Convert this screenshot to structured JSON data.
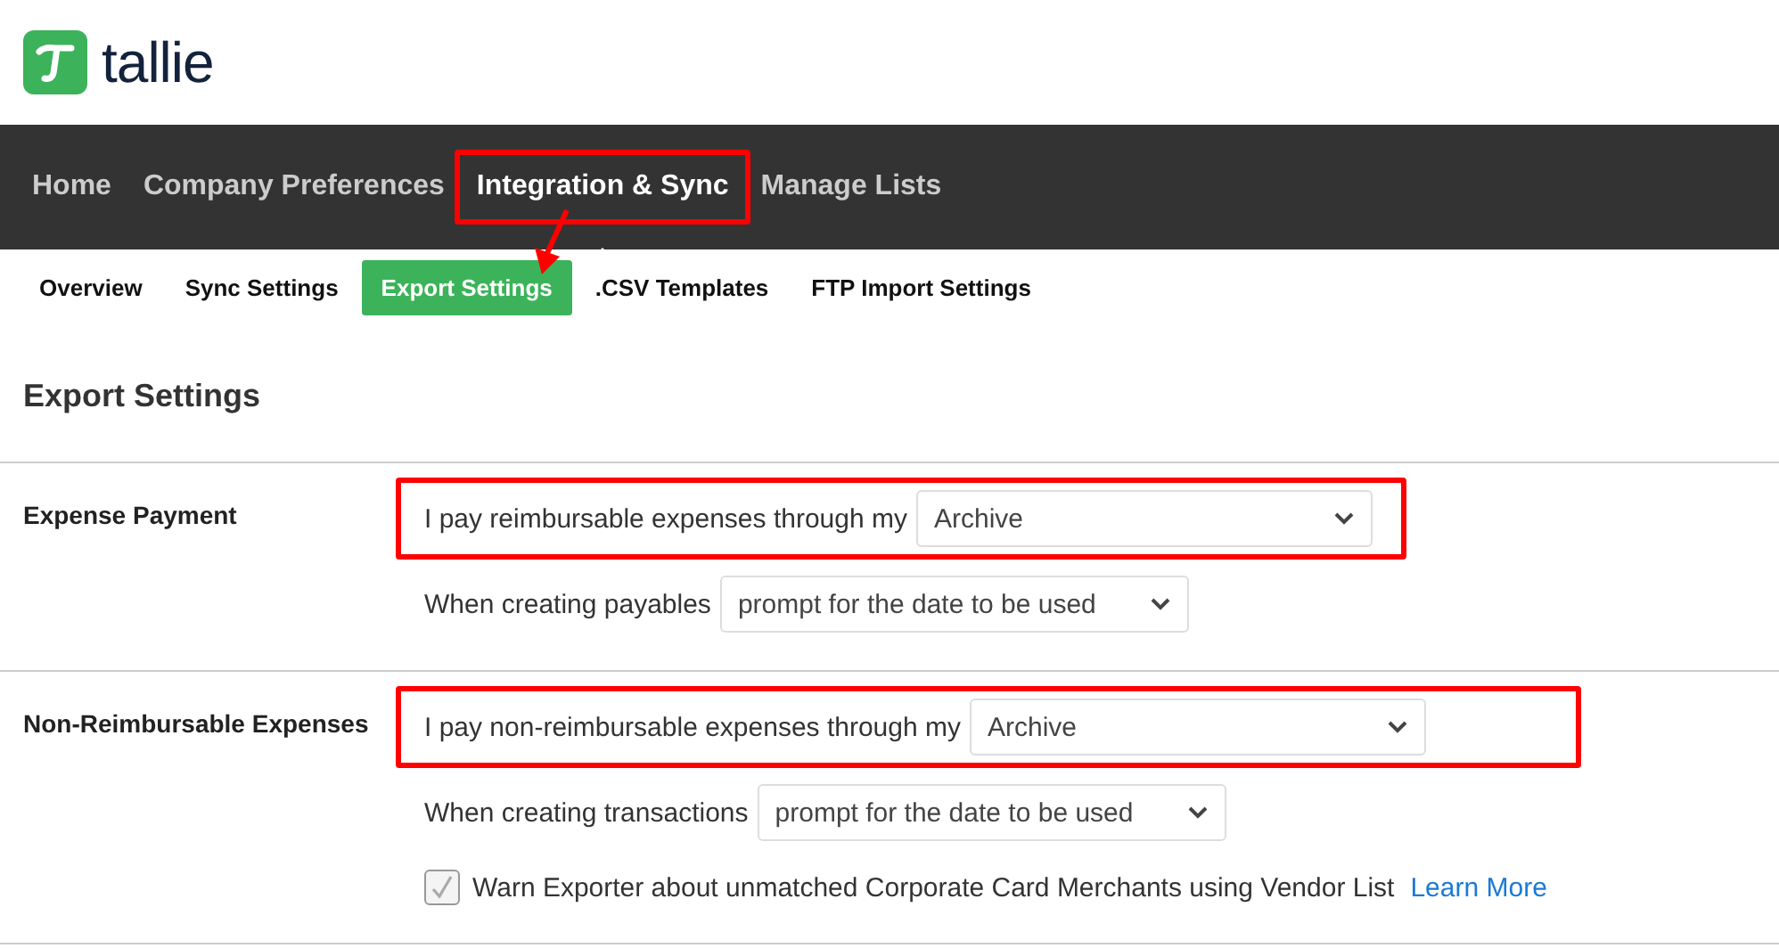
{
  "logo": {
    "text": "tallie"
  },
  "nav": [
    {
      "label": "Home",
      "selected": false,
      "highlighted": false
    },
    {
      "label": "Company Preferences",
      "selected": false,
      "highlighted": false
    },
    {
      "label": "Integration & Sync",
      "selected": true,
      "highlighted": true
    },
    {
      "label": "Manage Lists",
      "selected": false,
      "highlighted": false
    }
  ],
  "subnav": [
    {
      "label": "Overview",
      "selected": false
    },
    {
      "label": "Sync Settings",
      "selected": false
    },
    {
      "label": "Export Settings",
      "selected": true
    },
    {
      "label": ".CSV Templates",
      "selected": false
    },
    {
      "label": "FTP Import Settings",
      "selected": false
    }
  ],
  "annotation_arrow": true,
  "page_title": "Export Settings",
  "sections": [
    {
      "label": "Expense Payment",
      "rows": [
        {
          "kind": "select",
          "label": "I pay reimbursable expenses through my",
          "value": "Archive",
          "highlighted": true
        },
        {
          "kind": "select",
          "label": "When creating payables",
          "value": "prompt for the date to be used",
          "highlighted": false
        }
      ]
    },
    {
      "label": "Non-Reimbursable Expenses",
      "rows": [
        {
          "kind": "select",
          "label": "I pay non-reimbursable expenses through my",
          "value": "Archive",
          "highlighted": true
        },
        {
          "kind": "select",
          "label": "When creating transactions",
          "value": "prompt for the date to be used",
          "highlighted": false
        },
        {
          "kind": "checkbox",
          "label": "Warn Exporter about unmatched Corporate Card Merchants using Vendor List",
          "checked": true,
          "disabled": true,
          "link": "Learn More",
          "highlighted": false
        }
      ]
    }
  ]
}
